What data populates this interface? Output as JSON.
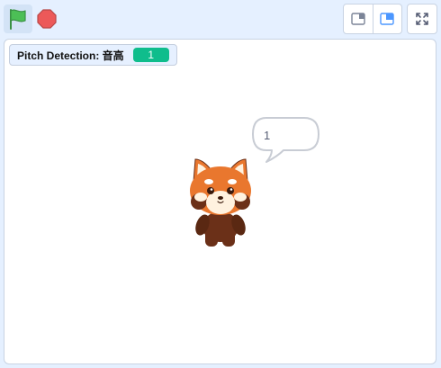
{
  "toolbar": {
    "green_flag_icon": "green-flag-icon",
    "stop_icon": "stop-sign-icon",
    "small_stage_icon": "small-stage-icon",
    "normal_stage_icon": "normal-stage-icon",
    "fullscreen_icon": "fullscreen-icon"
  },
  "monitor": {
    "label": "Pitch Detection: 音高",
    "value": "1"
  },
  "speech_bubble": {
    "text": "1"
  },
  "sprite": {
    "name": "red-panda"
  },
  "colors": {
    "background": "#e5f0ff",
    "flag_green": "#4cbf56",
    "stop_red": "#ec5959",
    "accent_blue": "#4c97ff",
    "monitor_value": "#0fbd8c",
    "panda_orange": "#e9772e",
    "panda_brown": "#6b3018"
  }
}
